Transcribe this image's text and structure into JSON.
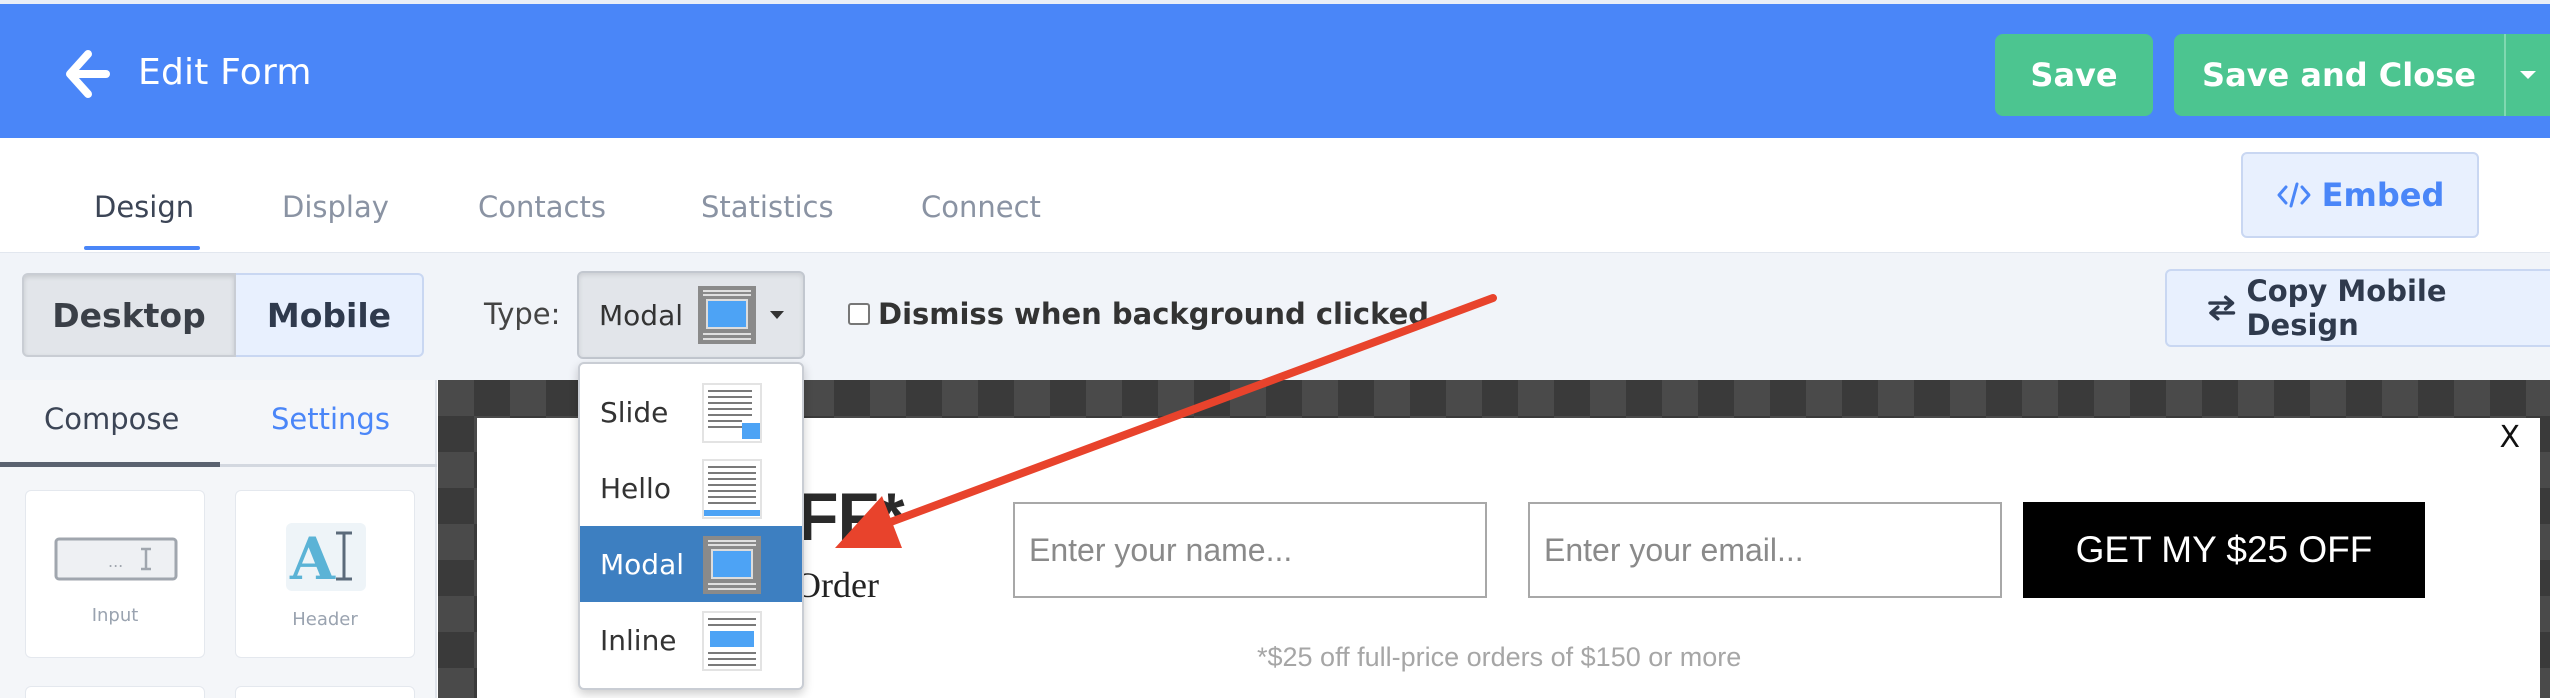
{
  "header": {
    "title": "Edit Form",
    "save_label": "Save",
    "save_close_label": "Save and Close",
    "brand_color": "#4a86f8",
    "save_color": "#4cc590"
  },
  "tabs": [
    {
      "label": "Design",
      "active": true
    },
    {
      "label": "Display",
      "active": false
    },
    {
      "label": "Contacts",
      "active": false
    },
    {
      "label": "Statistics",
      "active": false
    },
    {
      "label": "Connect",
      "active": false
    }
  ],
  "embed_label": "Embed",
  "toolbar": {
    "desktop_label": "Desktop",
    "mobile_label": "Mobile",
    "type_label": "Type:",
    "type_value": "Modal",
    "dismiss_label": "Dismiss when background clicked",
    "dismiss_checked": false,
    "copy_label": "Copy Mobile Design"
  },
  "left_panel": {
    "compose_label": "Compose",
    "settings_label": "Settings",
    "blocks": [
      {
        "label": "Input",
        "icon": "input-field-icon"
      },
      {
        "label": "Header",
        "icon": "text-header-icon"
      }
    ]
  },
  "dropdown": {
    "options": [
      {
        "label": "Slide",
        "icon": "slide-layout-icon",
        "selected": false
      },
      {
        "label": "Hello",
        "icon": "hello-bar-layout-icon",
        "selected": false
      },
      {
        "label": "Modal",
        "icon": "modal-layout-icon",
        "selected": true
      },
      {
        "label": "Inline",
        "icon": "inline-layout-icon",
        "selected": false
      }
    ]
  },
  "preview": {
    "headline": "FF*",
    "subline": "Order",
    "name_placeholder": "Enter your name...",
    "email_placeholder": "Enter your email...",
    "cta_label": "GET MY $25 OFF",
    "disclaimer": "*$25 off full-price orders of $150 or more",
    "close_label": "X"
  },
  "annotation": {
    "arrow_color": "#e8432c"
  }
}
